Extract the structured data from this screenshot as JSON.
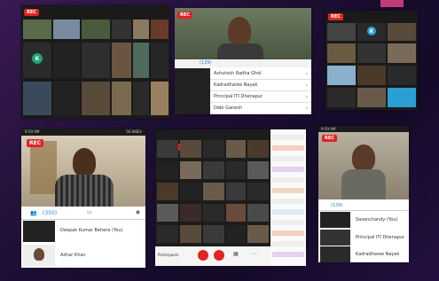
{
  "rec_label": "REC",
  "p1": {
    "avatar_letter": "K"
  },
  "p2": {
    "count": "(139)",
    "names": [
      "Ashutosh Radha Ghol",
      "Kadradharee Nayak",
      "Principal ITI Dhenapur",
      "Debi Ganesh"
    ]
  },
  "p3": {
    "avatar_letter": "K"
  },
  "p4": {
    "status_time": "9:59 AM",
    "status_right": "56.0KB/s",
    "count": "(350)",
    "names": [
      "Deepak Kumar Behera (You)",
      "Azhar Khan"
    ]
  },
  "p5": {
    "tab_label": "Participants"
  },
  "p6": {
    "status_time": "9:59 AM",
    "count": "(139)",
    "names": [
      "Sasanchandy (You)",
      "Principal ITI Dhenapur",
      "Kadradharee Nayak"
    ]
  },
  "colors": {
    "rec": "#e02424",
    "accent": "#2a9fd6",
    "bg": "#1d0f33"
  }
}
